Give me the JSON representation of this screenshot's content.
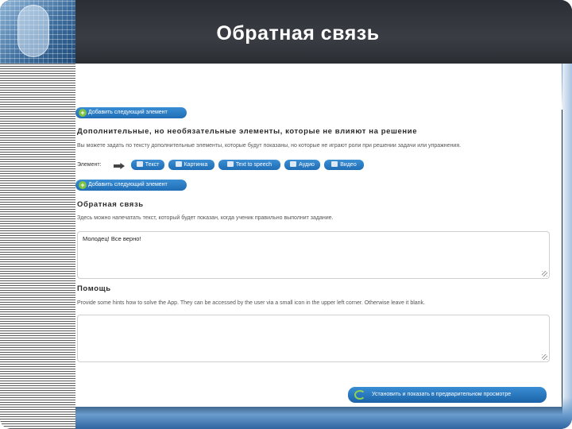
{
  "slide": {
    "title": "Обратная связь"
  },
  "editor": {
    "add_element_top": "Добавить следующий элемент",
    "optional_heading": "Дополнительные, но необязательные элементы, которые не влияют на решение",
    "optional_hint": "Вы можете задать по тексту дополнительные элементы, которые будут показаны, но которые не играют роли при решении задачи или упражнения.",
    "element_label": "Элемент:",
    "element_buttons": [
      {
        "label": "Текст",
        "icon": "text-icon"
      },
      {
        "label": "Картинка",
        "icon": "image-icon"
      },
      {
        "label": "Text to speech",
        "icon": "speech-icon"
      },
      {
        "label": "Аудио",
        "icon": "audio-icon"
      },
      {
        "label": "Видео",
        "icon": "video-icon"
      }
    ],
    "add_element_bottom": "Добавить следующий элемент",
    "feedback_heading": "Обратная связь",
    "feedback_hint": "Здесь можно напечатать текст, который будет показан, когда ученик правильно выполнит задание.",
    "feedback_value": "Молодец! Все верно!",
    "help_heading": "Помощь",
    "help_hint": "Provide some hints how to solve the App. They can be accessed by the user via a small icon in the upper left corner. Otherwise leave it blank.",
    "help_value": "",
    "preview_button": "Установить и показать в предварительном просмотре"
  },
  "colors": {
    "accent": "#1f6db5",
    "plus": "#7dc242"
  }
}
